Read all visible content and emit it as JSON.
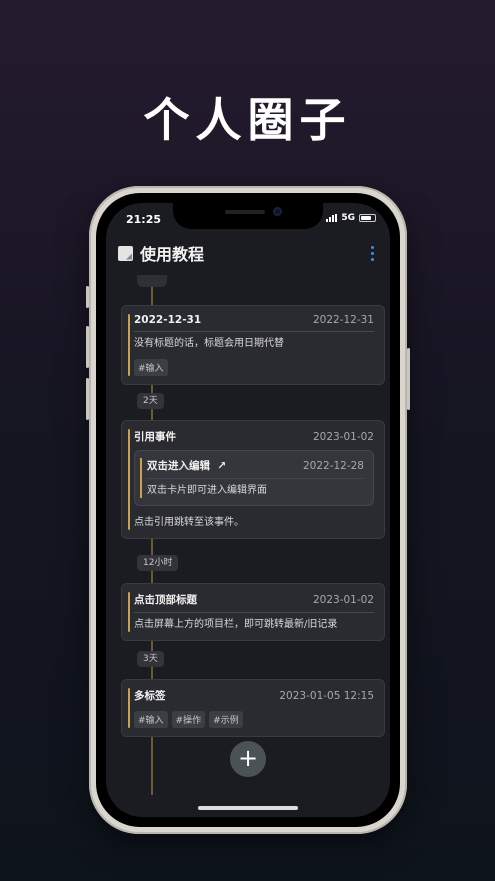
{
  "headline": "个人圈子",
  "status": {
    "time": "21:25",
    "network": "5G"
  },
  "appbar": {
    "title": "使用教程"
  },
  "cards": [
    {
      "title": "2022-12-31",
      "date": "2022-12-31",
      "body": "没有标题的话，标题会用日期代替",
      "tags": [
        "#输入"
      ]
    },
    {
      "title": "引用事件",
      "date": "2023-01-02",
      "nested": {
        "title": "双击进入编辑",
        "arrow": "↗",
        "date": "2022-12-28",
        "body": "双击卡片即可进入编辑界面"
      },
      "body": "点击引用跳转至该事件。"
    },
    {
      "title": "点击顶部标题",
      "date": "2023-01-02",
      "body": "点击屏幕上方的项目栏，即可跳转最新/旧记录"
    },
    {
      "title": "多标签",
      "date": "2023-01-05 12:15",
      "tags": [
        "#输入",
        "#操作",
        "#示例"
      ]
    }
  ],
  "gaps": [
    "2天",
    "12小时",
    "3天"
  ],
  "fab_label": "+",
  "colors": {
    "accent": "#c9a24b",
    "menu": "#3d8bff"
  }
}
